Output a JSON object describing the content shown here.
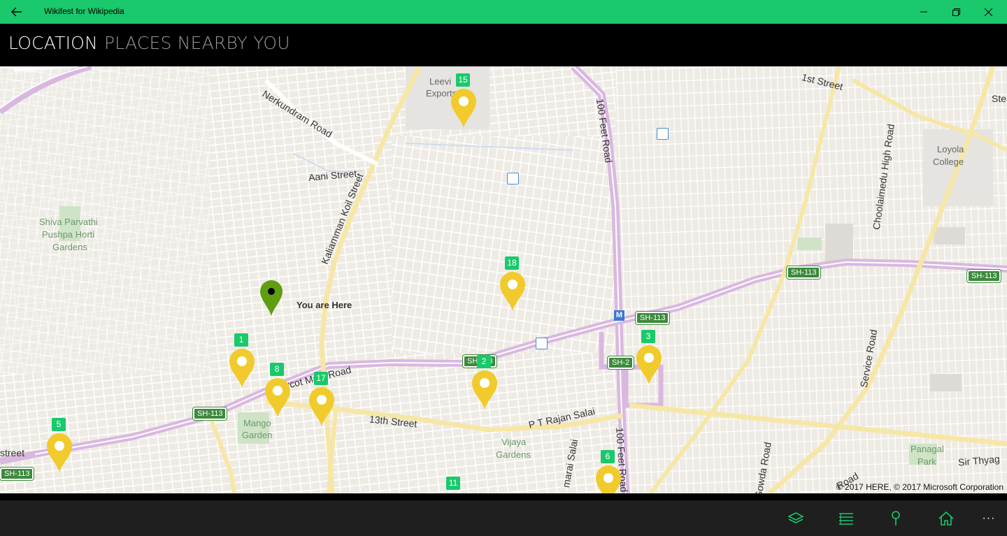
{
  "window": {
    "title": "Wikifest for Wikipedia",
    "back_icon": "arrow-left-icon",
    "minimize_icon": "minimize-icon",
    "maximize_icon": "restore-icon",
    "close_icon": "close-icon"
  },
  "pivot": {
    "tabs": [
      {
        "label": "LOCATION",
        "selected": true
      },
      {
        "label": "PLACES NEARBY YOU",
        "selected": false
      }
    ]
  },
  "map": {
    "you_are_here": "You are Here",
    "copyright": "© 2017 HERE, © 2017 Microsoft Corporation",
    "place_labels": [
      "Shiva Parvathi",
      "Pushpa Horti",
      "Gardens",
      "Mango",
      "Garden",
      "Vijaya",
      "Gardens",
      "Loyola",
      "College",
      "Panagal",
      "Park",
      "Leevi",
      "Exports"
    ],
    "road_labels": [
      "1st Street",
      "Nerkundram Road",
      "Aani Street",
      "Kaliamman Koil Street",
      "100 Feet Road",
      "Choolaimedu High Road",
      "Arcot Main Road",
      "13th Street",
      "P T Rajan Salai",
      "100 Feet Road",
      "Service Road",
      "Sir Thyag",
      "street",
      "Ste",
      "Gowda Road",
      "marai Salai",
      "Road"
    ],
    "shields": [
      "SH-113",
      "SH-113",
      "SH-113",
      "SH-113",
      "SH-113",
      "SH-2",
      "SH-113"
    ],
    "pins": [
      "15",
      "18",
      "1",
      "8",
      "17",
      "2",
      "3",
      "5",
      "6",
      "11"
    ],
    "accent": "#19c96b",
    "pin_color": "#f0cb2b",
    "location_pin_color": "#5f9e10"
  },
  "appbar": {
    "buttons": [
      {
        "name": "layers-icon"
      },
      {
        "name": "list-icon"
      },
      {
        "name": "pin-icon"
      },
      {
        "name": "home-icon"
      },
      {
        "name": "more-icon",
        "label": "···"
      }
    ]
  }
}
